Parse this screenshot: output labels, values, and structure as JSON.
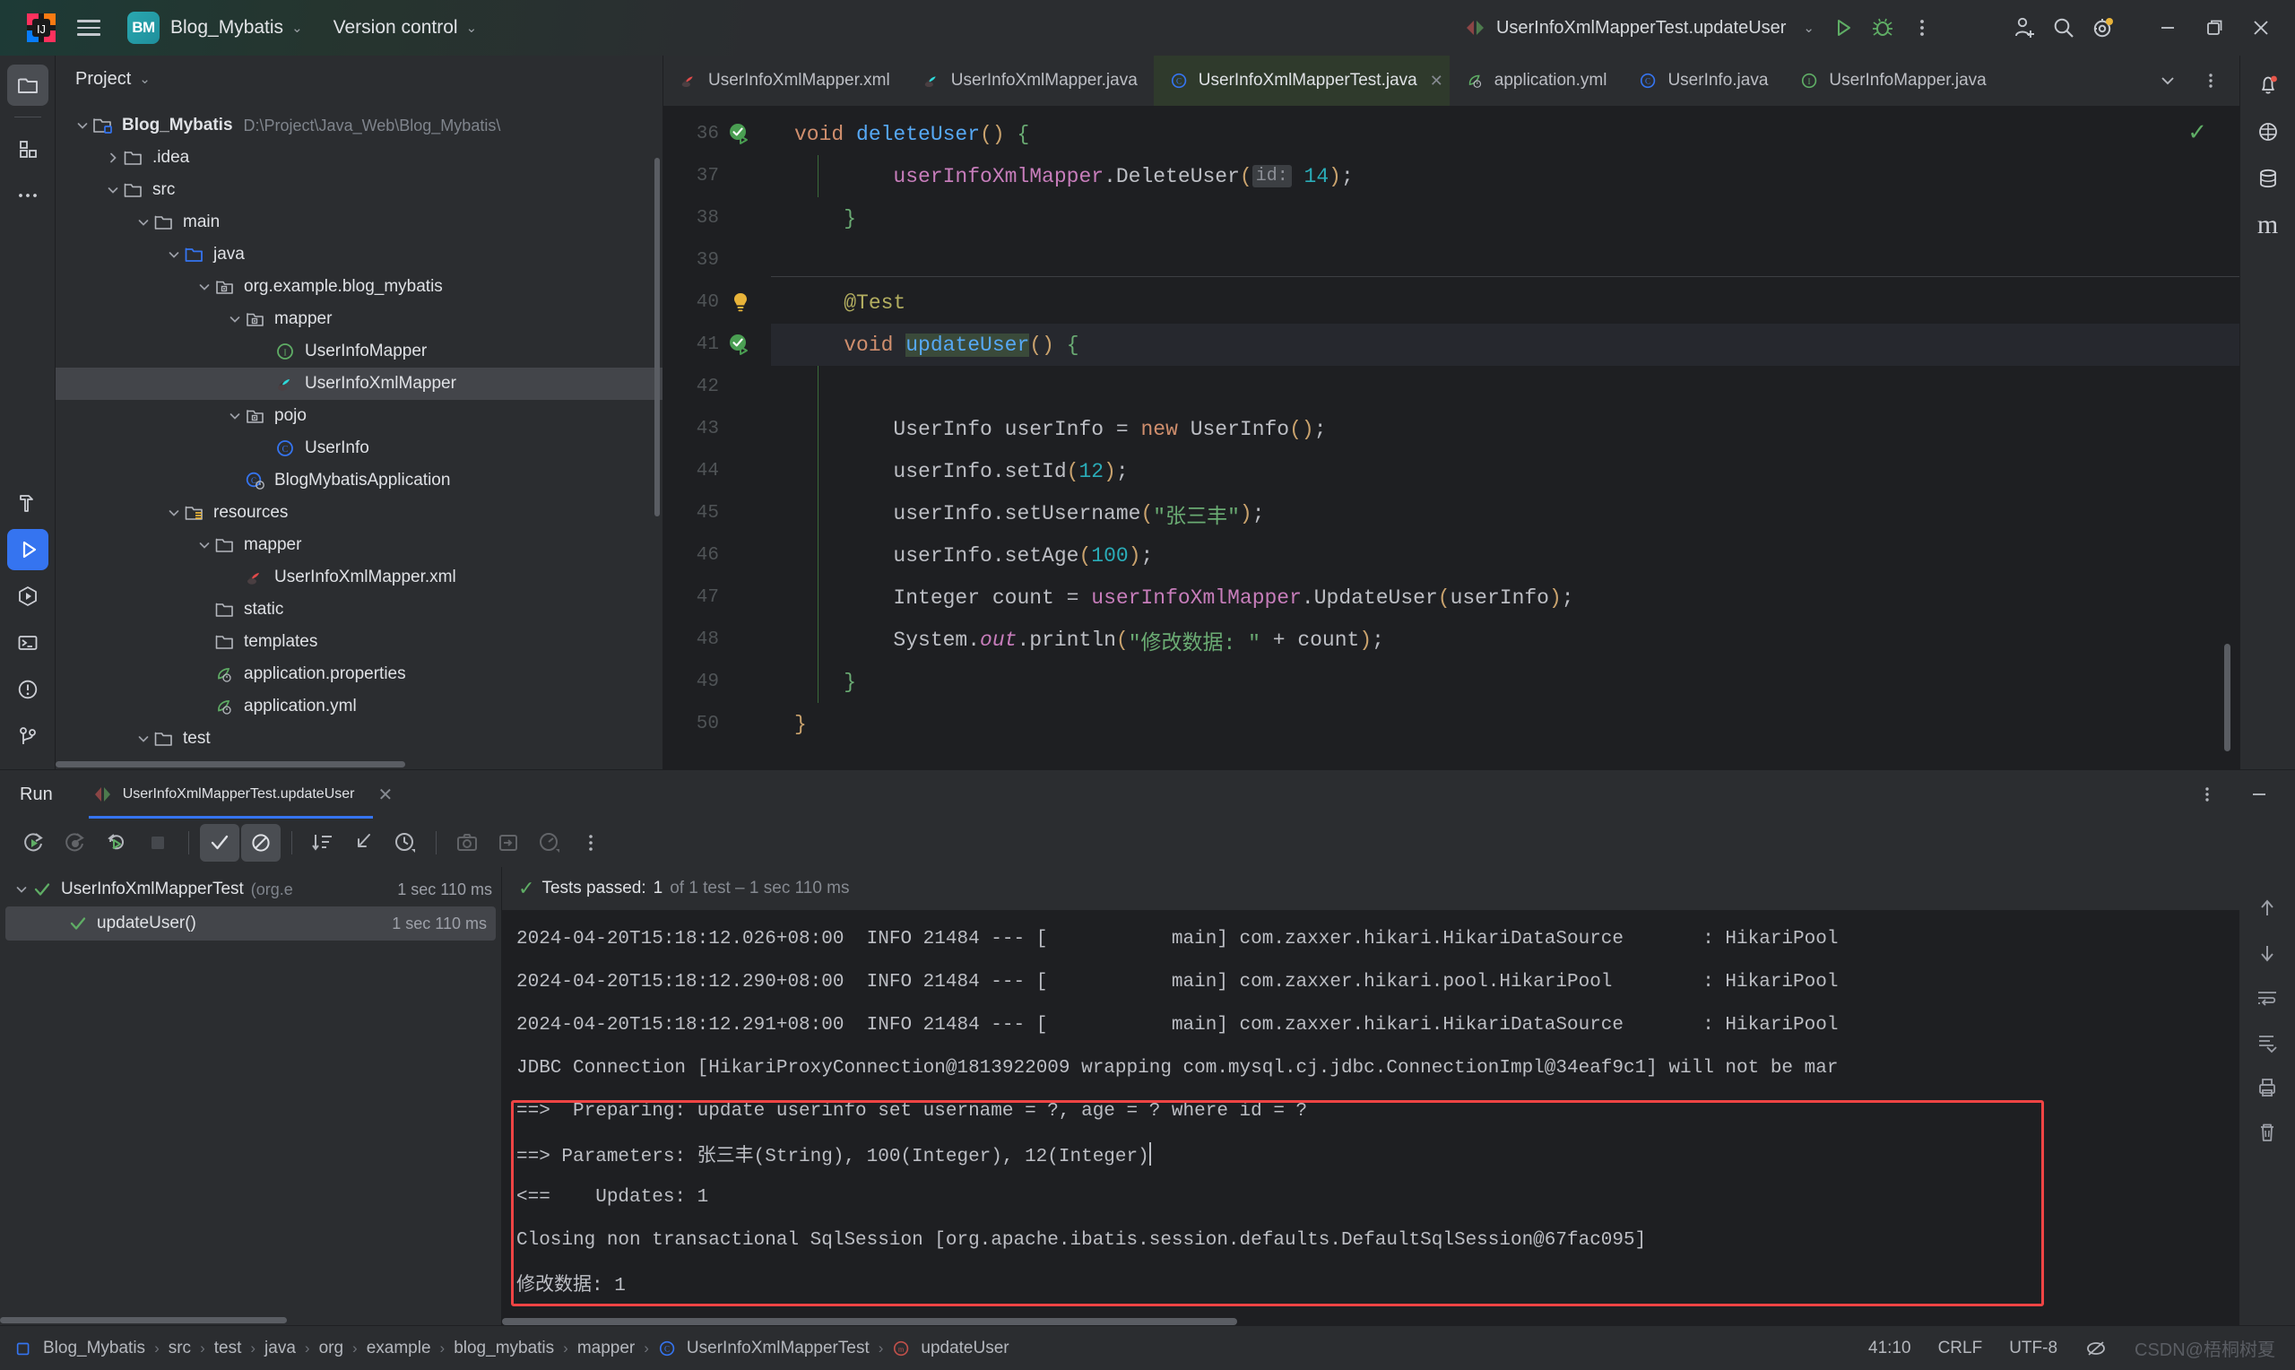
{
  "titlebar": {
    "menu_icon": "hamburger-icon",
    "project_badge": "BM",
    "project_name": "Blog_Mybatis",
    "version_control": "Version control",
    "run_config": "UserInfoXmlMapperTest.updateUser",
    "buttons": {
      "run": "run-icon",
      "debug": "debug-icon",
      "more": "more-vertical-icon",
      "account": "account-icon",
      "search": "search-icon",
      "settings": "settings-icon",
      "minimize": "minimize-icon",
      "maximize": "maximize-icon",
      "close": "close-icon"
    }
  },
  "left_toolstrip": [
    {
      "name": "project-tool-icon",
      "active": true
    },
    {
      "name": "structure-tool-icon",
      "active": false
    },
    {
      "name": "more-tools-icon",
      "active": false
    }
  ],
  "left_toolstrip_bottom": [
    {
      "name": "build-tool-icon",
      "active": false
    },
    {
      "name": "run-tool-icon",
      "active": true
    },
    {
      "name": "services-tool-icon",
      "active": false
    },
    {
      "name": "terminal-tool-icon",
      "active": false
    },
    {
      "name": "problems-tool-icon",
      "active": false
    },
    {
      "name": "git-tool-icon",
      "active": false
    }
  ],
  "right_toolstrip": [
    {
      "name": "notifications-icon"
    },
    {
      "name": "ai-assistant-icon"
    },
    {
      "name": "database-icon"
    },
    {
      "name": "maven-icon"
    }
  ],
  "project_panel": {
    "title": "Project",
    "tree": [
      {
        "depth": 0,
        "arrow": "down",
        "icon": "module-folder-icon",
        "label": "Blog_Mybatis",
        "bold": true,
        "path": "D:\\Project\\Java_Web\\Blog_Mybatis\\",
        "selected": false
      },
      {
        "depth": 1,
        "arrow": "right",
        "icon": "folder-icon",
        "label": ".idea",
        "bold": false,
        "path": "",
        "selected": false
      },
      {
        "depth": 1,
        "arrow": "down",
        "icon": "folder-icon",
        "label": "src",
        "bold": false,
        "path": "",
        "selected": false
      },
      {
        "depth": 2,
        "arrow": "down",
        "icon": "folder-icon",
        "label": "main",
        "bold": false,
        "path": "",
        "selected": false
      },
      {
        "depth": 3,
        "arrow": "down",
        "icon": "source-folder-icon",
        "label": "java",
        "bold": false,
        "path": "",
        "selected": false
      },
      {
        "depth": 4,
        "arrow": "down",
        "icon": "package-icon",
        "label": "org.example.blog_mybatis",
        "bold": false,
        "path": "",
        "selected": false
      },
      {
        "depth": 5,
        "arrow": "down",
        "icon": "package-icon",
        "label": "mapper",
        "bold": false,
        "path": "",
        "selected": false
      },
      {
        "depth": 6,
        "arrow": "none",
        "icon": "interface-icon",
        "label": "UserInfoMapper",
        "bold": false,
        "path": "",
        "selected": false
      },
      {
        "depth": 6,
        "arrow": "none",
        "icon": "mybatis-icon",
        "label": "UserInfoXmlMapper",
        "bold": false,
        "path": "",
        "selected": true
      },
      {
        "depth": 5,
        "arrow": "down",
        "icon": "package-icon",
        "label": "pojo",
        "bold": false,
        "path": "",
        "selected": false
      },
      {
        "depth": 6,
        "arrow": "none",
        "icon": "class-icon",
        "label": "UserInfo",
        "bold": false,
        "path": "",
        "selected": false
      },
      {
        "depth": 5,
        "arrow": "none",
        "icon": "spring-class-icon",
        "label": "BlogMybatisApplication",
        "bold": false,
        "path": "",
        "selected": false
      },
      {
        "depth": 3,
        "arrow": "down",
        "icon": "resources-folder-icon",
        "label": "resources",
        "bold": false,
        "path": "",
        "selected": false
      },
      {
        "depth": 4,
        "arrow": "down",
        "icon": "folder-icon",
        "label": "mapper",
        "bold": false,
        "path": "",
        "selected": false
      },
      {
        "depth": 5,
        "arrow": "none",
        "icon": "mybatis-xml-icon",
        "label": "UserInfoXmlMapper.xml",
        "bold": false,
        "path": "",
        "selected": false
      },
      {
        "depth": 4,
        "arrow": "none",
        "icon": "folder-icon",
        "label": "static",
        "bold": false,
        "path": "",
        "selected": false
      },
      {
        "depth": 4,
        "arrow": "none",
        "icon": "folder-icon",
        "label": "templates",
        "bold": false,
        "path": "",
        "selected": false
      },
      {
        "depth": 4,
        "arrow": "none",
        "icon": "spring-config-icon",
        "label": "application.properties",
        "bold": false,
        "path": "",
        "selected": false
      },
      {
        "depth": 4,
        "arrow": "none",
        "icon": "spring-config-icon",
        "label": "application.yml",
        "bold": false,
        "path": "",
        "selected": false
      },
      {
        "depth": 2,
        "arrow": "down",
        "icon": "folder-icon",
        "label": "test",
        "bold": false,
        "path": "",
        "selected": false
      }
    ]
  },
  "editor_tabs": [
    {
      "label": "UserInfoXmlMapper.xml",
      "icon": "mybatis-xml-icon",
      "active": false,
      "closable": false
    },
    {
      "label": "UserInfoXmlMapper.java",
      "icon": "mybatis-icon",
      "active": false,
      "closable": false
    },
    {
      "label": "UserInfoXmlMapperTest.java",
      "icon": "class-icon",
      "active": true,
      "closable": true
    },
    {
      "label": "application.yml",
      "icon": "spring-config-icon",
      "active": false,
      "closable": false
    },
    {
      "label": "UserInfo.java",
      "icon": "class-icon",
      "active": false,
      "closable": false
    },
    {
      "label": "UserInfoMapper.java",
      "icon": "interface-icon",
      "active": false,
      "closable": false
    }
  ],
  "editor": {
    "lines": [
      {
        "num": "36",
        "marker": "test-passed-gutter-icon",
        "highlight": false,
        "tokens": [
          {
            "t": "void ",
            "c": "k-kw"
          },
          {
            "t": "deleteUser",
            "c": "k-meth"
          },
          {
            "t": "()",
            "c": "k-punc"
          },
          {
            "t": " ",
            "c": "k-txt"
          },
          {
            "t": "{",
            "c": "k-brace"
          }
        ],
        "indent": 4
      },
      {
        "num": "37",
        "marker": "",
        "highlight": false,
        "tokens": [
          {
            "t": "        ",
            "c": "k-txt"
          },
          {
            "t": "userInfoXmlMapper",
            "c": "k-field"
          },
          {
            "t": ".",
            "c": "k-txt"
          },
          {
            "t": "DeleteUser",
            "c": "k-txt"
          },
          {
            "t": "(",
            "c": "k-punc"
          },
          {
            "t": "id:",
            "c": "k-hint"
          },
          {
            "t": " ",
            "c": "k-txt"
          },
          {
            "t": "14",
            "c": "k-num"
          },
          {
            "t": ")",
            "c": "k-punc"
          },
          {
            "t": ";",
            "c": "k-txt"
          }
        ],
        "indent": 8
      },
      {
        "num": "38",
        "marker": "",
        "highlight": false,
        "tokens": [
          {
            "t": "    ",
            "c": "k-txt"
          },
          {
            "t": "}",
            "c": "k-brace"
          }
        ],
        "indent": 4
      },
      {
        "num": "39",
        "marker": "",
        "highlight": false,
        "tokens": [],
        "indent": 0
      },
      {
        "num": "40",
        "marker": "intention-bulb-icon",
        "highlight": false,
        "tokens": [
          {
            "t": "    ",
            "c": "k-txt"
          },
          {
            "t": "@Test",
            "c": "k-ann"
          }
        ],
        "indent": 4
      },
      {
        "num": "41",
        "marker": "test-passed-gutter-icon",
        "highlight": true,
        "tokens": [
          {
            "t": "    ",
            "c": "k-txt"
          },
          {
            "t": "void ",
            "c": "k-kw"
          },
          {
            "t": "updateUser",
            "c": "k-meth sel-hl"
          },
          {
            "t": "()",
            "c": "k-punc"
          },
          {
            "t": " ",
            "c": "k-txt"
          },
          {
            "t": "{",
            "c": "k-brace"
          }
        ],
        "indent": 4
      },
      {
        "num": "42",
        "marker": "",
        "highlight": false,
        "tokens": [],
        "indent": 0
      },
      {
        "num": "43",
        "marker": "",
        "highlight": false,
        "tokens": [
          {
            "t": "        ",
            "c": "k-txt"
          },
          {
            "t": "UserInfo userInfo = ",
            "c": "k-txt"
          },
          {
            "t": "new ",
            "c": "k-kw"
          },
          {
            "t": "UserInfo",
            "c": "k-txt"
          },
          {
            "t": "()",
            "c": "k-punc"
          },
          {
            "t": ";",
            "c": "k-txt"
          }
        ],
        "indent": 8
      },
      {
        "num": "44",
        "marker": "",
        "highlight": false,
        "tokens": [
          {
            "t": "        ",
            "c": "k-txt"
          },
          {
            "t": "userInfo.setId",
            "c": "k-txt"
          },
          {
            "t": "(",
            "c": "k-punc"
          },
          {
            "t": "12",
            "c": "k-num"
          },
          {
            "t": ")",
            "c": "k-punc"
          },
          {
            "t": ";",
            "c": "k-txt"
          }
        ],
        "indent": 8
      },
      {
        "num": "45",
        "marker": "",
        "highlight": false,
        "tokens": [
          {
            "t": "        ",
            "c": "k-txt"
          },
          {
            "t": "userInfo.setUsername",
            "c": "k-txt"
          },
          {
            "t": "(",
            "c": "k-punc"
          },
          {
            "t": "\"张三丰\"",
            "c": "k-str"
          },
          {
            "t": ")",
            "c": "k-punc"
          },
          {
            "t": ";",
            "c": "k-txt"
          }
        ],
        "indent": 8
      },
      {
        "num": "46",
        "marker": "",
        "highlight": false,
        "tokens": [
          {
            "t": "        ",
            "c": "k-txt"
          },
          {
            "t": "userInfo.setAge",
            "c": "k-txt"
          },
          {
            "t": "(",
            "c": "k-punc"
          },
          {
            "t": "100",
            "c": "k-num"
          },
          {
            "t": ")",
            "c": "k-punc"
          },
          {
            "t": ";",
            "c": "k-txt"
          }
        ],
        "indent": 8
      },
      {
        "num": "47",
        "marker": "",
        "highlight": false,
        "tokens": [
          {
            "t": "        ",
            "c": "k-txt"
          },
          {
            "t": "Integer count = ",
            "c": "k-txt"
          },
          {
            "t": "userInfoXmlMapper",
            "c": "k-field"
          },
          {
            "t": ".",
            "c": "k-txt"
          },
          {
            "t": "UpdateUser",
            "c": "k-txt"
          },
          {
            "t": "(",
            "c": "k-punc"
          },
          {
            "t": "userInfo",
            "c": "k-txt"
          },
          {
            "t": ")",
            "c": "k-punc"
          },
          {
            "t": ";",
            "c": "k-txt"
          }
        ],
        "indent": 8
      },
      {
        "num": "48",
        "marker": "",
        "highlight": false,
        "tokens": [
          {
            "t": "        ",
            "c": "k-txt"
          },
          {
            "t": "System.",
            "c": "k-txt"
          },
          {
            "t": "out",
            "c": "k-stat"
          },
          {
            "t": ".println",
            "c": "k-txt"
          },
          {
            "t": "(",
            "c": "k-punc"
          },
          {
            "t": "\"修改数据: \"",
            "c": "k-str"
          },
          {
            "t": " + count",
            "c": "k-txt"
          },
          {
            "t": ")",
            "c": "k-punc"
          },
          {
            "t": ";",
            "c": "k-txt"
          }
        ],
        "indent": 8
      },
      {
        "num": "49",
        "marker": "",
        "highlight": false,
        "tokens": [
          {
            "t": "    ",
            "c": "k-txt"
          },
          {
            "t": "}",
            "c": "k-brace"
          }
        ],
        "indent": 4
      },
      {
        "num": "50",
        "marker": "",
        "highlight": false,
        "tokens": [
          {
            "t": "}",
            "c": "k-punc"
          }
        ],
        "indent": 0
      }
    ]
  },
  "run_panel": {
    "tool_label": "Run",
    "tab_label": "UserInfoXmlMapperTest.updateUser",
    "toolbar": [
      {
        "name": "rerun-button",
        "state": "enabled"
      },
      {
        "name": "rerun-failed-button",
        "state": "disabled"
      },
      {
        "name": "rerun-auto-button",
        "state": "enabled"
      },
      {
        "name": "stop-button",
        "state": "disabled"
      },
      {
        "name": "show-passed-toggle",
        "state": "toggled"
      },
      {
        "name": "show-ignored-toggle",
        "state": "toggled"
      },
      {
        "name": "sort-by-duration-button",
        "state": "enabled"
      },
      {
        "name": "expand-collapse-button",
        "state": "enabled"
      },
      {
        "name": "history-button",
        "state": "enabled"
      },
      {
        "name": "export-button",
        "state": "disabled"
      },
      {
        "name": "import-button",
        "state": "disabled"
      },
      {
        "name": "profiler-button",
        "state": "disabled"
      },
      {
        "name": "more-options-button",
        "state": "enabled"
      }
    ],
    "test_tree": [
      {
        "depth": 0,
        "arrow": "down",
        "status": "passed",
        "label": "UserInfoXmlMapperTest",
        "pkg": "(org.e",
        "time": "1 sec 110 ms",
        "selected": false
      },
      {
        "depth": 1,
        "arrow": "none",
        "status": "passed",
        "label": "updateUser()",
        "pkg": "",
        "time": "1 sec 110 ms",
        "selected": true
      }
    ],
    "status": {
      "prefix": "Tests passed:",
      "count": "1",
      "suffix": "of 1 test – 1 sec 110 ms"
    },
    "console_lines": [
      {
        "text": "2024-04-20T15:18:12.026+08:00  INFO 21484 --- [           main] com.zaxxer.hikari.HikariDataSource       : HikariPool",
        "boxed": false
      },
      {
        "text": "2024-04-20T15:18:12.290+08:00  INFO 21484 --- [           main] com.zaxxer.hikari.pool.HikariPool        : HikariPool",
        "boxed": false
      },
      {
        "text": "2024-04-20T15:18:12.291+08:00  INFO 21484 --- [           main] com.zaxxer.hikari.HikariDataSource       : HikariPool",
        "boxed": false
      },
      {
        "text": "JDBC Connection [HikariProxyConnection@1813922009 wrapping com.mysql.cj.jdbc.ConnectionImpl@34eaf9c1] will not be mar",
        "boxed": false
      },
      {
        "text": "==>  Preparing: update userinfo set username = ?, age = ? where id = ?",
        "boxed": true
      },
      {
        "text": "==> Parameters: 张三丰(String), 100(Integer), 12(Integer)",
        "boxed": true,
        "caret": true
      },
      {
        "text": "<==    Updates: 1",
        "boxed": true
      },
      {
        "text": "Closing non transactional SqlSession [org.apache.ibatis.session.defaults.DefaultSqlSession@67fac095]",
        "boxed": true
      },
      {
        "text": "修改数据: 1",
        "boxed": true
      }
    ],
    "console_side_buttons": [
      {
        "name": "scroll-up-icon"
      },
      {
        "name": "scroll-down-icon"
      },
      {
        "name": "soft-wrap-icon"
      },
      {
        "name": "scroll-to-end-icon"
      },
      {
        "name": "print-icon"
      },
      {
        "name": "clear-all-icon"
      }
    ],
    "header_right": [
      {
        "name": "run-panel-options-icon"
      },
      {
        "name": "hide-panel-icon"
      }
    ]
  },
  "statusbar": {
    "breadcrumbs": [
      {
        "label": "Blog_Mybatis",
        "icon": "module-icon"
      },
      {
        "label": "src",
        "icon": ""
      },
      {
        "label": "test",
        "icon": ""
      },
      {
        "label": "java",
        "icon": ""
      },
      {
        "label": "org",
        "icon": ""
      },
      {
        "label": "example",
        "icon": ""
      },
      {
        "label": "blog_mybatis",
        "icon": ""
      },
      {
        "label": "mapper",
        "icon": ""
      },
      {
        "label": "UserInfoXmlMapperTest",
        "icon": "class-icon"
      },
      {
        "label": "updateUser",
        "icon": "method-icon"
      }
    ],
    "caret_position": "41:10",
    "line_separator": "CRLF",
    "encoding": "UTF-8",
    "indent_icon": "no-read-only-icon",
    "watermark": "CSDN@梧桐树夏"
  },
  "colors": {
    "accent_blue": "#3574f0",
    "active_tab_bg": "#2f3a2c",
    "panel_bg": "#2b2d30",
    "editor_bg": "#1e1f22",
    "highlight_box": "#ef4444",
    "pass_green": "#5fad65"
  }
}
